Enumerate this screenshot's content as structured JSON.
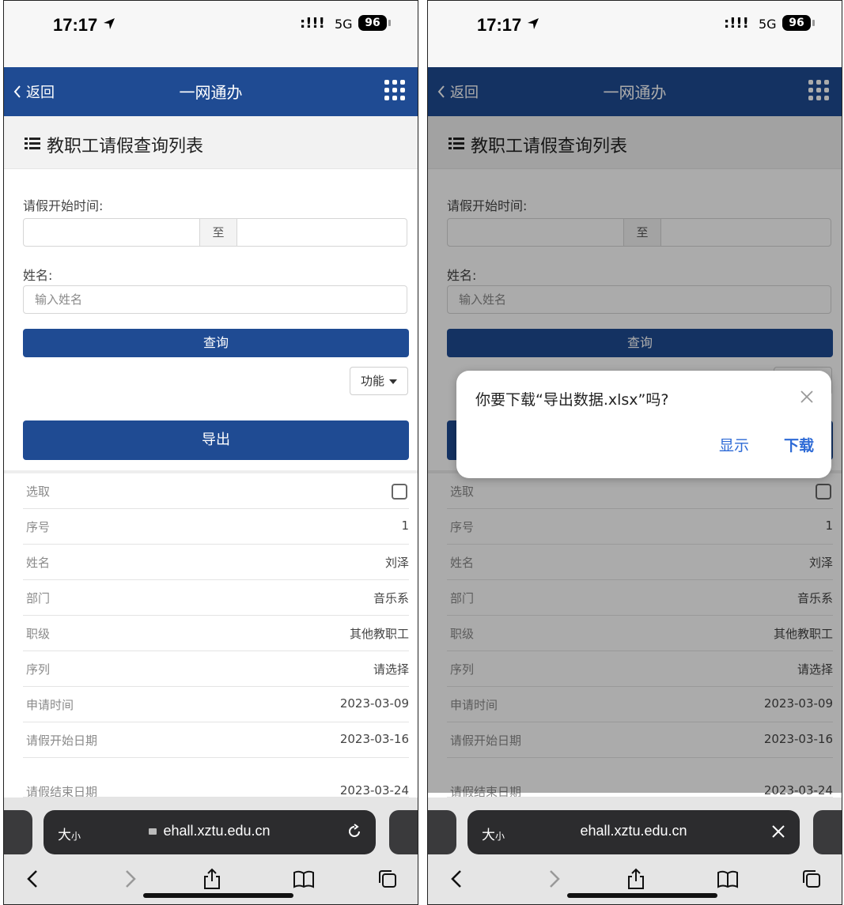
{
  "status": {
    "time": "17:17",
    "signal": ":!!!",
    "network": "5G",
    "battery": "96"
  },
  "nav": {
    "back_label": "返回",
    "title": "一网通办"
  },
  "page": {
    "title": "教职工请假查询列表"
  },
  "filters": {
    "start_label": "请假开始时间:",
    "range_to": "至",
    "name_label": "姓名:",
    "name_placeholder": "输入姓名",
    "query_label": "查询",
    "function_label": "功能",
    "export_label": "导出"
  },
  "record": [
    {
      "label": "选取",
      "value": ""
    },
    {
      "label": "序号",
      "value": "1"
    },
    {
      "label": "姓名",
      "value": "刘泽"
    },
    {
      "label": "部门",
      "value": "音乐系"
    },
    {
      "label": "职级",
      "value": "其他教职工"
    },
    {
      "label": "序列",
      "value": "请选择"
    },
    {
      "label": "申请时间",
      "value": "2023-03-09"
    },
    {
      "label": "请假开始日期",
      "value": "2023-03-16"
    },
    {
      "label": "请假结束日期",
      "value": "2023-03-24"
    }
  ],
  "browser": {
    "size_big": "大",
    "size_small": "小",
    "url": "ehall.xztu.edu.cn"
  },
  "dialog": {
    "message": "你要下载“导出数据.xlsx”吗?",
    "show_label": "显示",
    "download_label": "下载"
  },
  "colors": {
    "brand_blue": "#1f4b93",
    "link_blue": "#2d6ad6"
  }
}
